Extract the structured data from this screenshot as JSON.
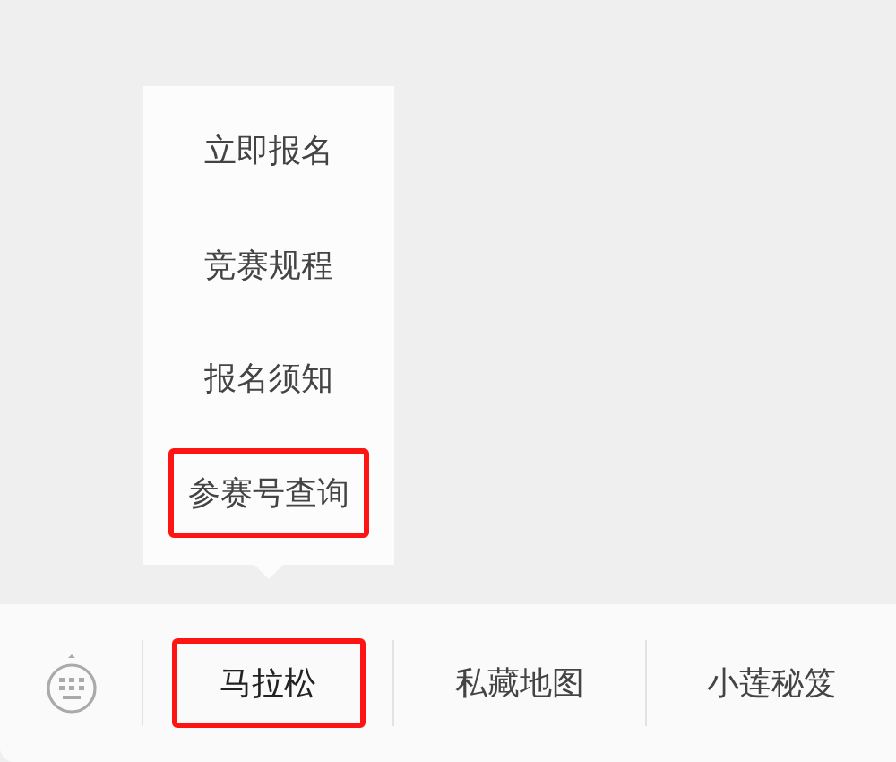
{
  "submenu": {
    "items": [
      {
        "label": "立即报名",
        "highlighted": false
      },
      {
        "label": "竞赛规程",
        "highlighted": false
      },
      {
        "label": "报名须知",
        "highlighted": false
      },
      {
        "label": "参赛号查询",
        "highlighted": true
      }
    ]
  },
  "menu_bar": {
    "items": [
      {
        "label": "马拉松",
        "highlighted": true
      },
      {
        "label": "私藏地图",
        "highlighted": false
      },
      {
        "label": "小莲秘笈",
        "highlighted": false
      }
    ]
  }
}
